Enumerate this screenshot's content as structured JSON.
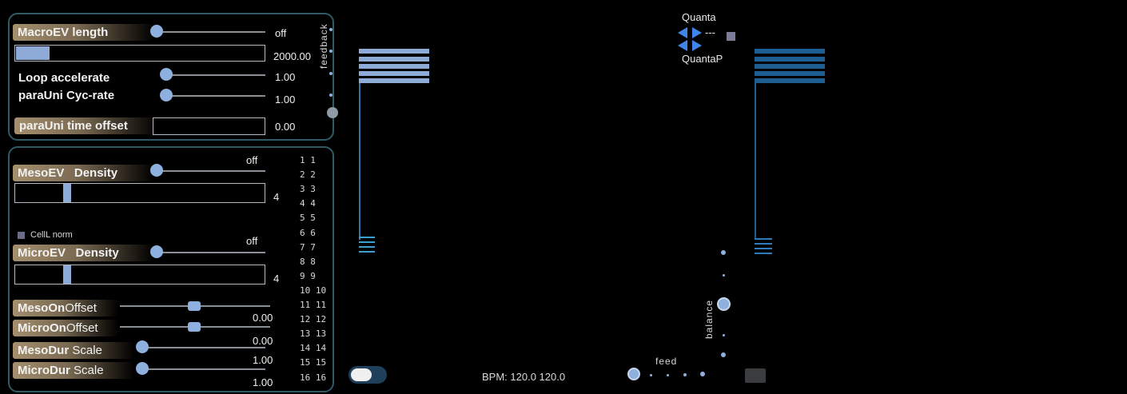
{
  "macro": {
    "length_label": "MacroEV length",
    "length_value": "off",
    "length_box_value": "2000.00",
    "loop_label": "Loop accelerate",
    "loop_value": "1.00",
    "cyc_label_a": "paraUni",
    "cyc_label_b": "Cyc-rate",
    "cyc_value": "1.00",
    "time_offset_label": "paraUni time offset",
    "time_offset_value": "0.00",
    "feedback_label": "feedback"
  },
  "meso": {
    "status": "off",
    "label_a": "MesoEV",
    "label_b": "Density",
    "value": "4",
    "cell_norm": "CellL norm",
    "micro_status": "off",
    "micro_label_a": "MicroEV",
    "micro_label_b": "Density",
    "micro_value": "4",
    "meso_on_a": "MesoOn",
    "meso_on_b": "Offset",
    "meso_on_value": "0.00",
    "micro_on_a": "MicroOn",
    "micro_on_b": "Offset",
    "micro_on_value": "0.00",
    "meso_dur_a": "MesoDur",
    "meso_dur_b": "Scale",
    "meso_dur_value": "1.00",
    "micro_dur_a": "MicroDur",
    "micro_dur_b": "Scale",
    "micro_dur_value": "1.00",
    "numbers": [
      "1 1",
      "2 2",
      "3 3",
      "4 4",
      "5 5",
      "6 6",
      "7 7",
      "8 8",
      "9 9",
      "10 10",
      "11 11",
      "12 12",
      "13 13",
      "14 14",
      "15 15",
      "16 16"
    ]
  },
  "transport": {
    "bpm": "BPM: 120.0 120.0",
    "feed_label": "feed",
    "balance_label": "balance"
  },
  "quanta": {
    "top_label": "Quanta",
    "value": "---",
    "bottom_label": "QuantaP"
  },
  "colors": {
    "accent": "#8eb0de",
    "left_bars": "#8eaad6",
    "right_bars": "#1d5e93",
    "panel_border": "#2f5a66"
  }
}
